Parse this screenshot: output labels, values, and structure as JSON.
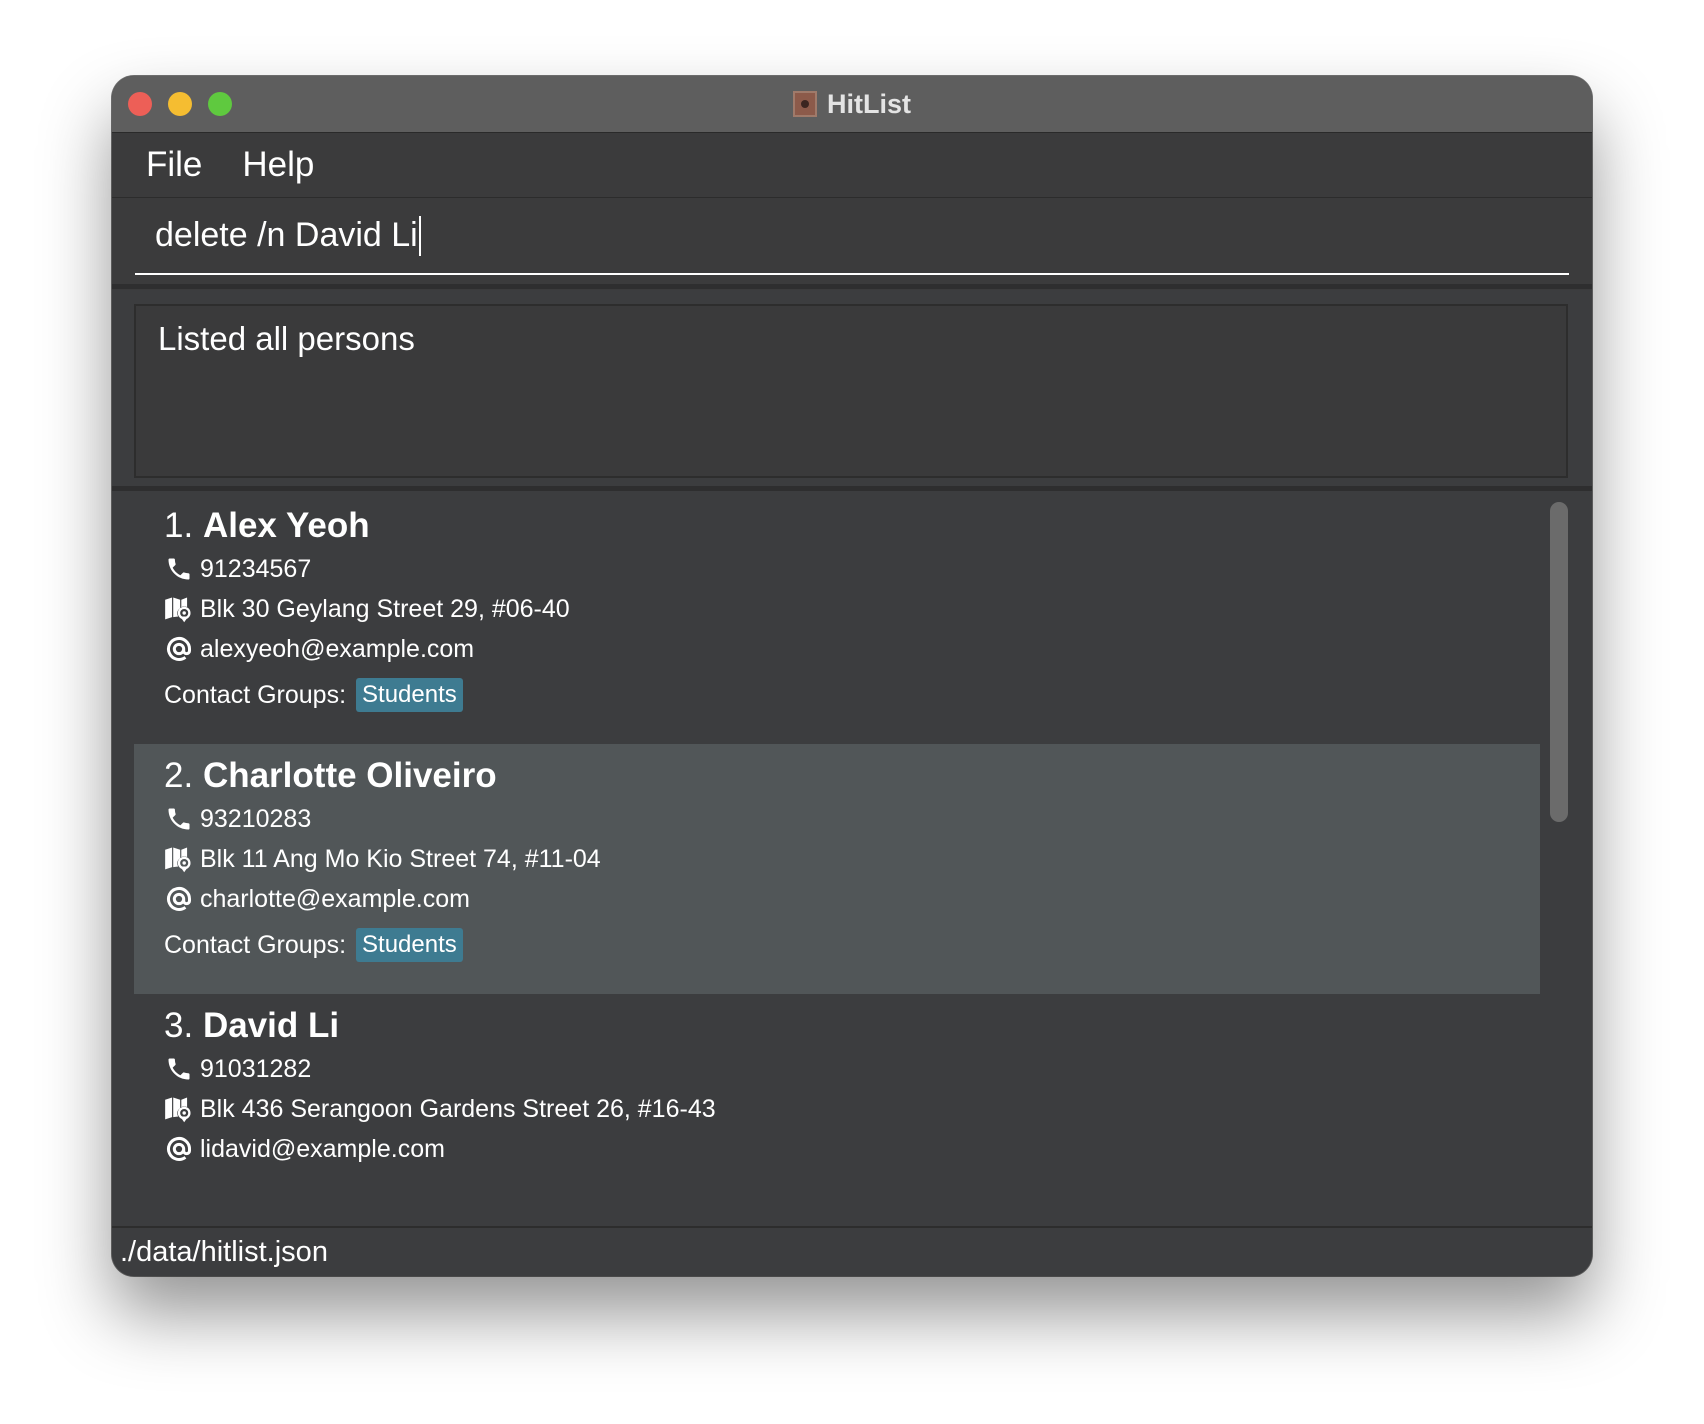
{
  "window": {
    "title": "HitList",
    "app_icon": "hitlist-app-icon"
  },
  "menu": {
    "items": [
      {
        "label": "File"
      },
      {
        "label": "Help"
      }
    ]
  },
  "command_box": {
    "value": "delete /n David Li"
  },
  "result_display": {
    "text": "Listed all persons"
  },
  "persons": {
    "contact_groups_label": "Contact Groups:",
    "items": [
      {
        "index": "1.",
        "name": "Alex Yeoh",
        "phone": "91234567",
        "address": "Blk 30 Geylang Street 29, #06-40",
        "email": "alexyeoh@example.com",
        "groups": [
          "Students"
        ]
      },
      {
        "index": "2.",
        "name": "Charlotte Oliveiro",
        "phone": "93210283",
        "address": "Blk 11 Ang Mo Kio Street 74, #11-04",
        "email": "charlotte@example.com",
        "groups": [
          "Students"
        ]
      },
      {
        "index": "3.",
        "name": "David Li",
        "phone": "91031282",
        "address": "Blk 436 Serangoon Gardens Street 26, #16-43",
        "email": "lidavid@example.com",
        "groups": []
      }
    ]
  },
  "status_bar": {
    "file_path": "./data/hitlist.json"
  },
  "colors": {
    "window_bg": "#3c3d3f",
    "selected_card_bg": "#515658",
    "tag_bg": "#3e7b91",
    "close": "#ed5f57",
    "minimize": "#f5bd31",
    "zoom": "#5fc93f"
  }
}
